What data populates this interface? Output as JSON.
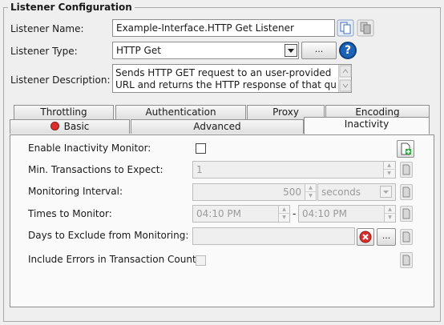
{
  "group": {
    "title": "Listener Configuration"
  },
  "listener_name": {
    "label": "Listener Name:",
    "value": "Example-Interface.HTTP Get Listener"
  },
  "listener_type": {
    "label": "Listener Type:",
    "value": "HTTP Get",
    "more_label": "...",
    "help_label": "?"
  },
  "listener_description": {
    "label": "Listener Description:",
    "lines": [
      "Sends HTTP GET request to an user-provided",
      "URL and returns the HTTP response of that query"
    ]
  },
  "tabs": {
    "row1": [
      "Throttling",
      "Authentication",
      "Proxy",
      "Encoding"
    ],
    "row2": [
      "Basic",
      "Advanced",
      "Inactivity"
    ],
    "selected": "Inactivity"
  },
  "inactivity": {
    "enable_label": "Enable Inactivity Monitor:",
    "min_tx_label": "Min. Transactions to Expect:",
    "min_tx_value": "1",
    "interval_label": "Monitoring Interval:",
    "interval_value": "500",
    "interval_unit": "seconds",
    "times_label": "Times to Monitor:",
    "time_start": "04:10 PM",
    "time_sep": "-",
    "time_end": "04:10 PM",
    "days_label": "Days to Exclude from Monitoring:",
    "days_more_label": "...",
    "errors_label": "Include Errors in Transaction Count:"
  },
  "colors": {
    "accent": "#1f5fa8",
    "error": "#d9302c",
    "help": "#1c63b7"
  }
}
